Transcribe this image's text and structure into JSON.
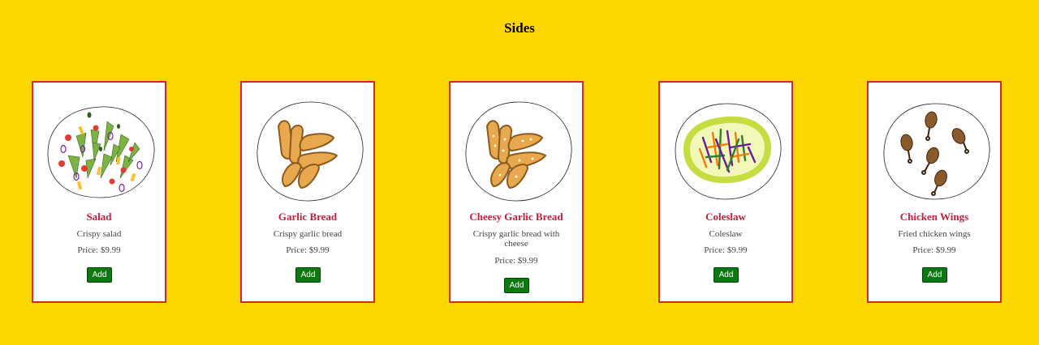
{
  "page": {
    "title": "Sides"
  },
  "items": [
    {
      "name": "Salad",
      "description": "Crispy salad",
      "price": "Price: $9.99",
      "button": "Add",
      "image": "salad-plate"
    },
    {
      "name": "Garlic Bread",
      "description": "Crispy garlic bread",
      "price": "Price: $9.99",
      "button": "Add",
      "image": "garlic-bread-plate"
    },
    {
      "name": "Cheesy Garlic Bread",
      "description": "Crispy garlic bread with cheese",
      "price": "Price: $9.99",
      "button": "Add",
      "image": "cheesy-garlic-bread-plate"
    },
    {
      "name": "Coleslaw",
      "description": "Coleslaw",
      "price": "Price: $9.99",
      "button": "Add",
      "image": "coleslaw-plate"
    },
    {
      "name": "Chicken Wings",
      "description": "Fried chicken wings",
      "price": "Price: $9.99",
      "button": "Add",
      "image": "chicken-wings-plate"
    }
  ],
  "colors": {
    "background": "#FFD700",
    "card_border": "#D02A2A",
    "item_name": "#C41E3A",
    "add_button": "#0A7A10"
  }
}
